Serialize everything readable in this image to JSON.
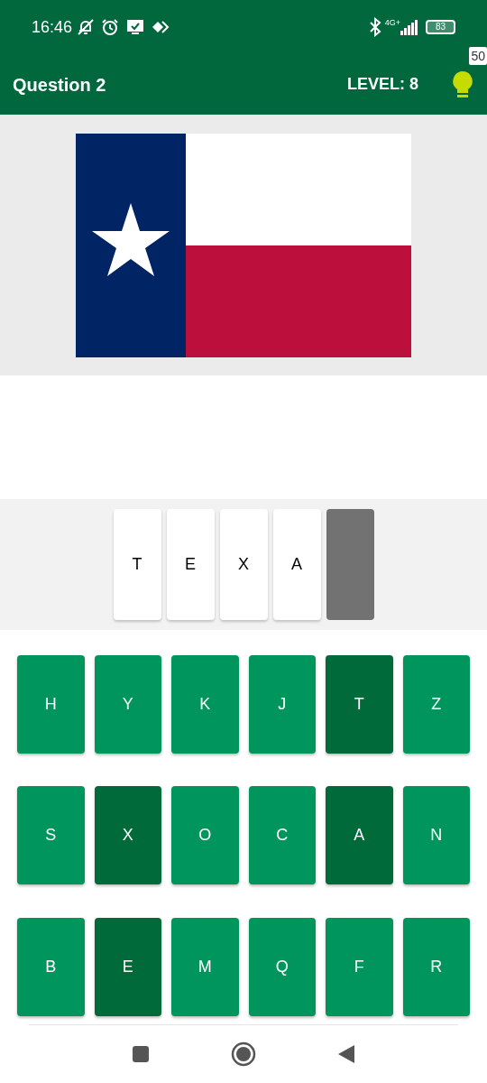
{
  "status_bar": {
    "time": "16:46",
    "network": "4G+",
    "battery": "83"
  },
  "header": {
    "title": "Question 2",
    "level": "LEVEL: 8",
    "hints": "50"
  },
  "answer_slots": [
    {
      "letter": "T",
      "filled": true
    },
    {
      "letter": "E",
      "filled": true
    },
    {
      "letter": "X",
      "filled": true
    },
    {
      "letter": "A",
      "filled": true
    },
    {
      "filled": false
    }
  ],
  "keyboard": [
    {
      "letter": "H",
      "used": false
    },
    {
      "letter": "Y",
      "used": false
    },
    {
      "letter": "K",
      "used": false
    },
    {
      "letter": "J",
      "used": false
    },
    {
      "letter": "T",
      "used": true
    },
    {
      "letter": "Z",
      "used": false
    },
    {
      "letter": "S",
      "used": false
    },
    {
      "letter": "X",
      "used": true
    },
    {
      "letter": "O",
      "used": false
    },
    {
      "letter": "C",
      "used": false
    },
    {
      "letter": "A",
      "used": true
    },
    {
      "letter": "N",
      "used": false
    },
    {
      "letter": "B",
      "used": false
    },
    {
      "letter": "E",
      "used": true
    },
    {
      "letter": "M",
      "used": false
    },
    {
      "letter": "Q",
      "used": false
    },
    {
      "letter": "F",
      "used": false
    },
    {
      "letter": "R",
      "used": false
    }
  ]
}
